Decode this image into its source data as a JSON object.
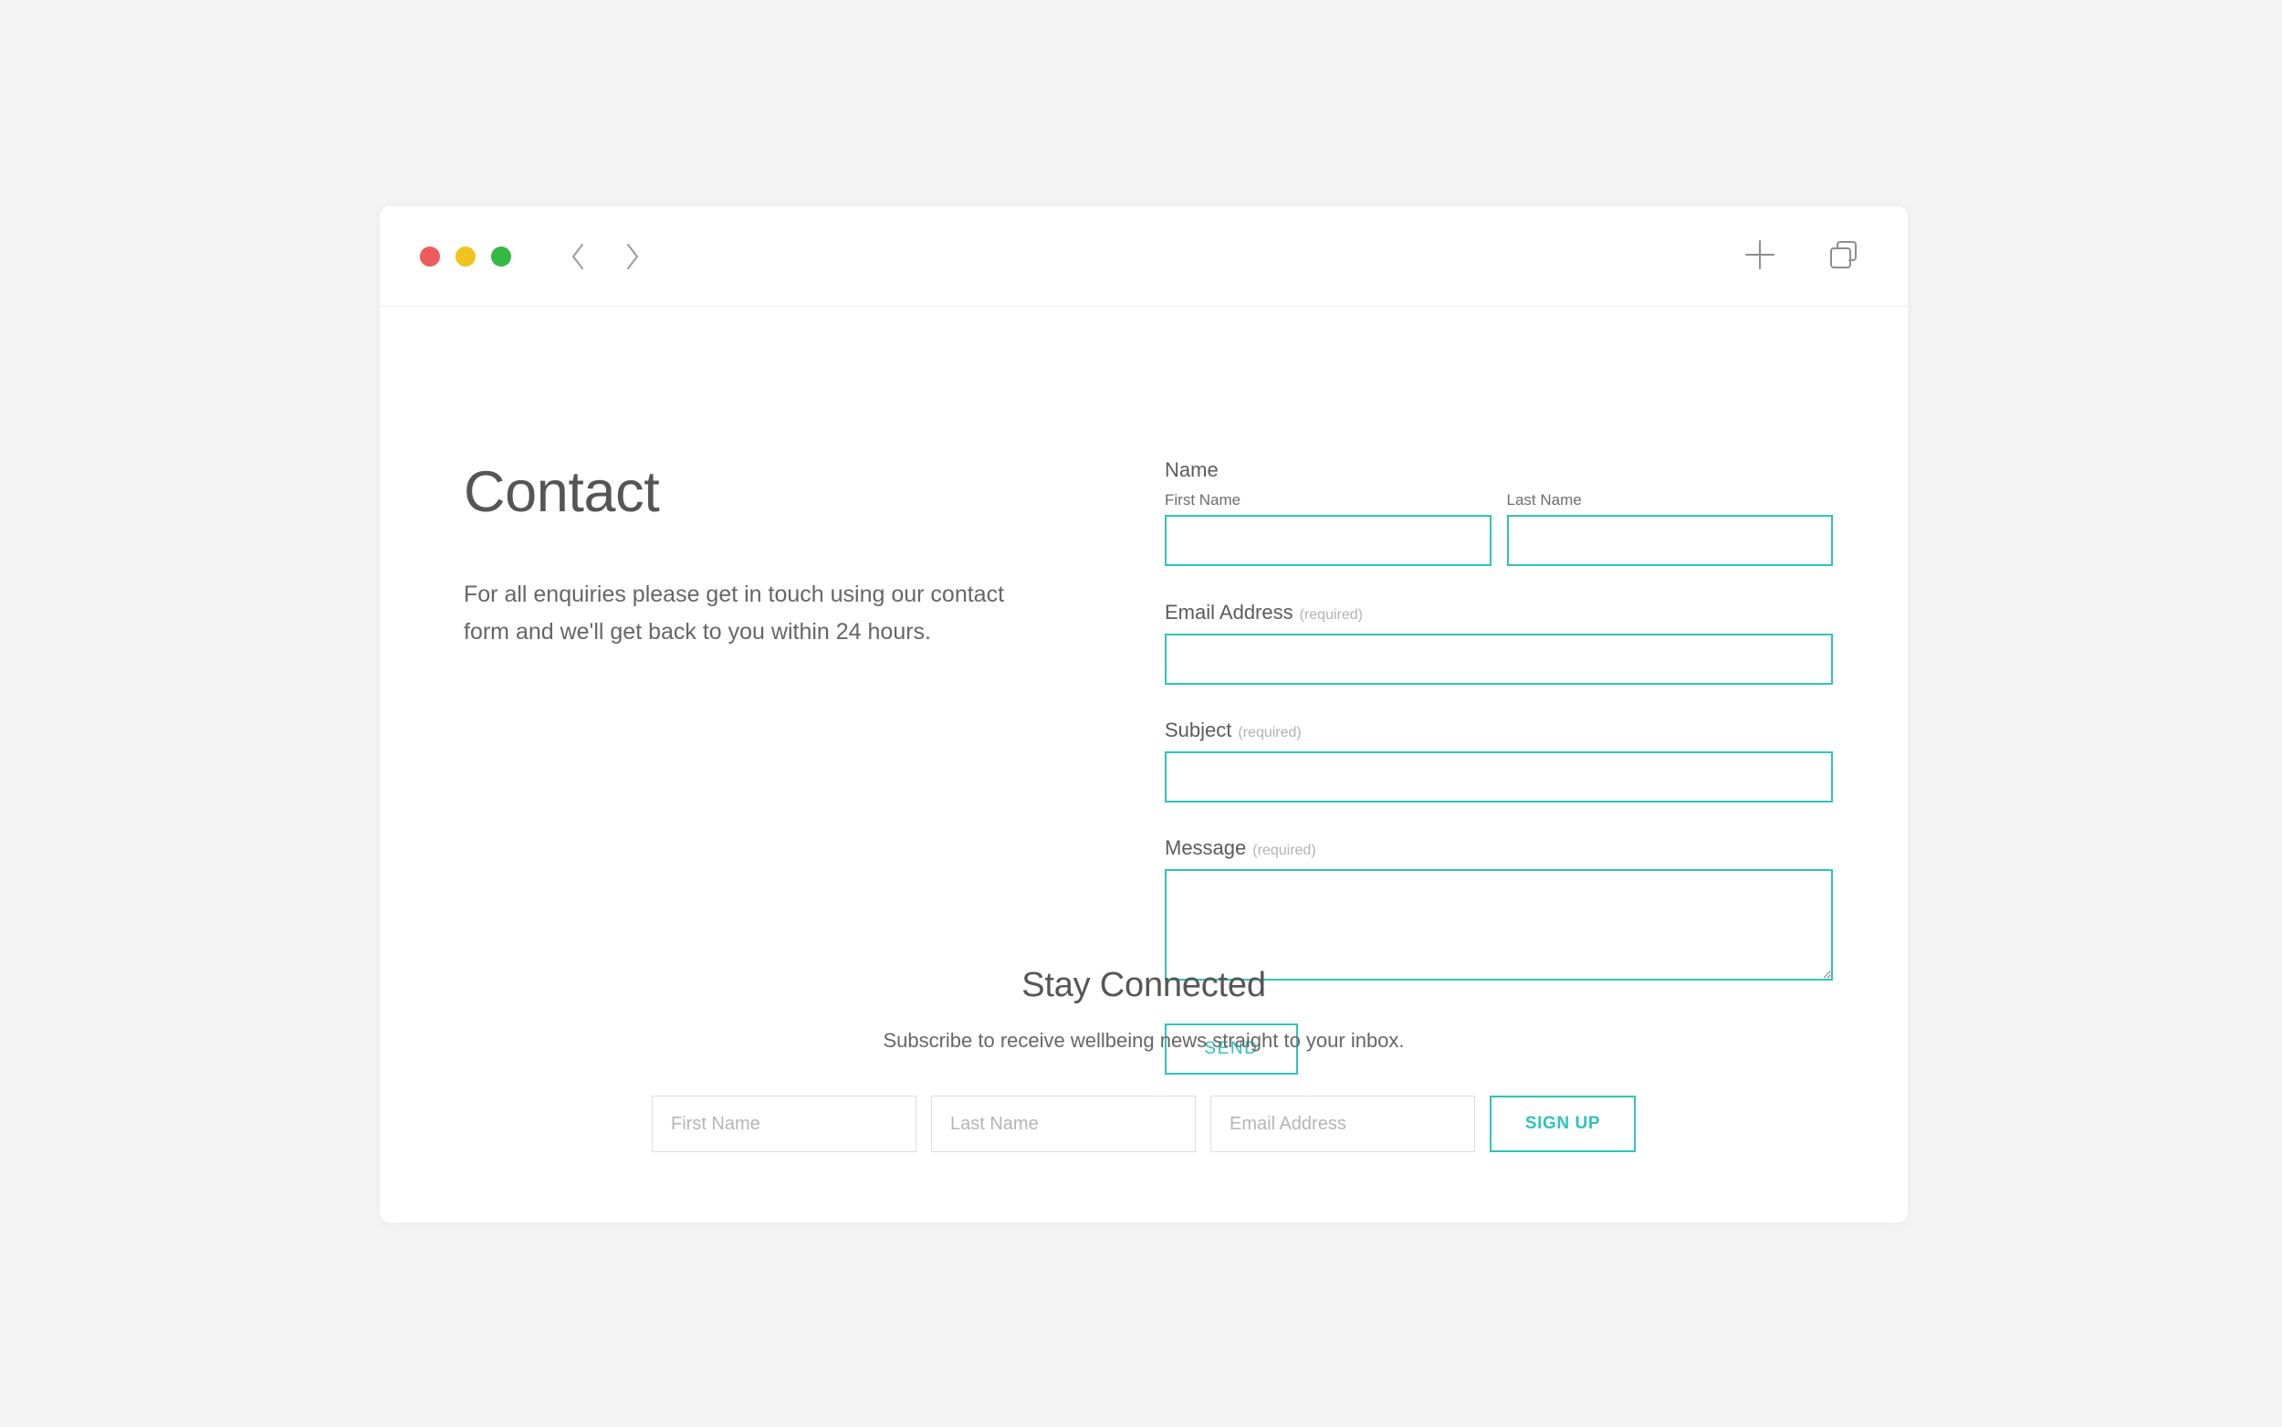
{
  "browser": {
    "traffic_lights": [
      {
        "name": "close",
        "color": "#ee5b5b"
      },
      {
        "name": "minimize",
        "color": "#f0c31e"
      },
      {
        "name": "maximize",
        "color": "#35b943"
      }
    ],
    "back_icon": "chevron-left-icon",
    "forward_icon": "chevron-right-icon",
    "search": {
      "value": "",
      "placeholder": "",
      "icon": "search-icon"
    },
    "new_tab_icon": "plus-icon",
    "tab_overview_icon": "duplicate-tabs-icon"
  },
  "page": {
    "title": "Contact",
    "intro": "For all enquiries please get in touch using our contact form and we'll get back to you within 24 hours."
  },
  "form": {
    "name": {
      "label": "Name",
      "first": {
        "sub_label": "First Name",
        "value": "",
        "placeholder": ""
      },
      "last": {
        "sub_label": "Last Name",
        "value": "",
        "placeholder": ""
      }
    },
    "email": {
      "label": "Email Address",
      "required_note": "(required)",
      "value": "",
      "placeholder": ""
    },
    "subject": {
      "label": "Subject",
      "required_note": "(required)",
      "value": "",
      "placeholder": ""
    },
    "message": {
      "label": "Message",
      "required_note": "(required)",
      "value": "",
      "placeholder": ""
    },
    "submit_label": "SEND"
  },
  "footer": {
    "title": "Stay Connected",
    "subtitle": "Subscribe to receive wellbeing news straight to your inbox.",
    "first_name_placeholder": "First Name",
    "last_name_placeholder": "Last Name",
    "email_placeholder": "Email Address",
    "first_name_value": "",
    "last_name_value": "",
    "email_value": "",
    "signup_label": "SIGN UP"
  },
  "colors": {
    "accent": "#2ec4bd",
    "page_background": "#f4f4f4",
    "window_background": "#ffffff",
    "heading_text": "#555555",
    "body_text": "#666666",
    "muted_text": "#b2b2b2",
    "input_border_light": "#dedede"
  }
}
